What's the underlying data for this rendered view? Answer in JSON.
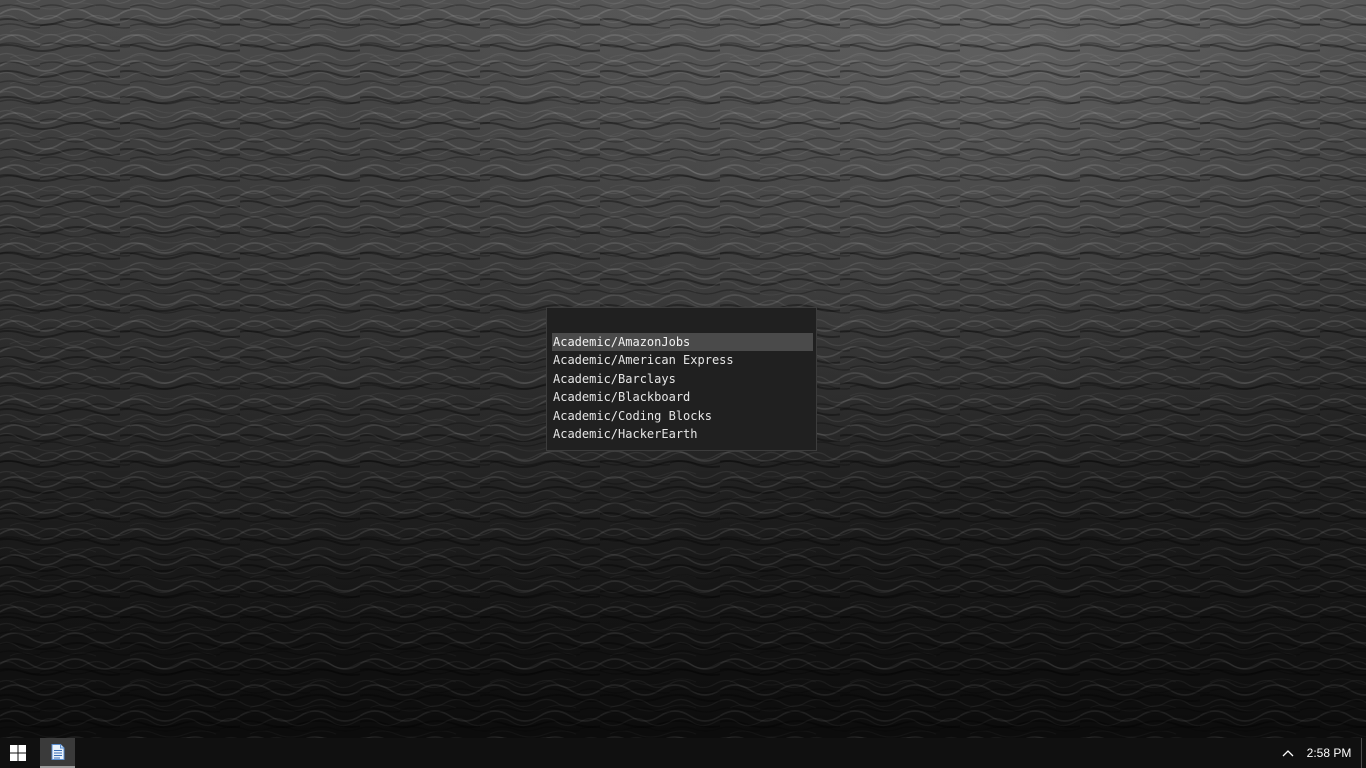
{
  "desktop": {
    "wallpaper": "dark-ocean-waves"
  },
  "launcher": {
    "query": "",
    "placeholder": "",
    "items": [
      {
        "label": "Academic/AmazonJobs",
        "selected": true
      },
      {
        "label": "Academic/American Express",
        "selected": false
      },
      {
        "label": "Academic/Barclays",
        "selected": false
      },
      {
        "label": "Academic/Blackboard",
        "selected": false
      },
      {
        "label": "Academic/Coding Blocks",
        "selected": false
      },
      {
        "label": "Academic/HackerEarth",
        "selected": false
      }
    ]
  },
  "taskbar": {
    "start_icon": "windows-logo-icon",
    "pinned_apps": [
      {
        "icon": "notepad-document-icon",
        "active": true
      }
    ],
    "tray_icon": "chevron-up-icon",
    "clock": "2:58 PM"
  },
  "colors": {
    "launcher_bg": "#202020",
    "selected_bg": "#4a4a4a",
    "taskbar_bg": "#101010",
    "text": "#e6e6e6"
  }
}
